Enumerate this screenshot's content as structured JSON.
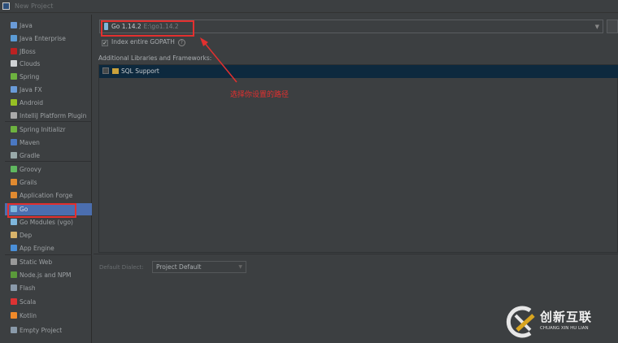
{
  "window": {
    "title": "New Project"
  },
  "sidebar": {
    "items": [
      {
        "label": "Java",
        "icon": "java-folder-icon",
        "color": "#6a9bd8"
      },
      {
        "label": "Java Enterprise",
        "icon": "java-ee-icon",
        "color": "#5b9bd5"
      },
      {
        "label": "JBoss",
        "icon": "jboss-icon",
        "color": "#b22"
      },
      {
        "label": "Clouds",
        "icon": "clouds-icon",
        "color": "#cfd2d4"
      },
      {
        "label": "Spring",
        "icon": "spring-icon",
        "color": "#6db33f"
      },
      {
        "label": "Java FX",
        "icon": "javafx-folder-icon",
        "color": "#6a9bd8"
      },
      {
        "label": "Android",
        "icon": "android-icon",
        "color": "#97c024"
      },
      {
        "label": "IntelliJ Platform Plugin",
        "icon": "plugin-icon",
        "color": "#aaa"
      },
      {
        "label": "Spring Initializr",
        "icon": "spring-initializr-icon",
        "color": "#6db33f"
      },
      {
        "label": "Maven",
        "icon": "maven-icon",
        "color": "#4a78c2"
      },
      {
        "label": "Gradle",
        "icon": "gradle-icon",
        "color": "#9aa"
      },
      {
        "label": "Groovy",
        "icon": "groovy-icon",
        "color": "#5fb85f"
      },
      {
        "label": "Grails",
        "icon": "grails-icon",
        "color": "#e08a30"
      },
      {
        "label": "Application Forge",
        "icon": "application-forge-icon",
        "color": "#e08a30"
      },
      {
        "label": "Go",
        "icon": "go-icon",
        "color": "#7eb6dc",
        "selected": true
      },
      {
        "label": "Go Modules (vgo)",
        "icon": "go-modules-icon",
        "color": "#7eb6dc"
      },
      {
        "label": "Dep",
        "icon": "dep-icon",
        "color": "#d8b36a"
      },
      {
        "label": "App Engine",
        "icon": "app-engine-icon",
        "color": "#4a8fd8"
      },
      {
        "label": "Static Web",
        "icon": "static-web-icon",
        "color": "#999"
      },
      {
        "label": "Node.js and NPM",
        "icon": "nodejs-icon",
        "color": "#5a9a3a"
      },
      {
        "label": "Flash",
        "icon": "flash-icon",
        "color": "#8a9aaa"
      },
      {
        "label": "Scala",
        "icon": "scala-icon",
        "color": "#d33"
      },
      {
        "label": "Kotlin",
        "icon": "kotlin-icon",
        "color": "#f08a2a"
      },
      {
        "label": "Empty Project",
        "icon": "empty-project-icon",
        "color": "#8a9aaa"
      }
    ]
  },
  "sdk": {
    "name": "Go 1.14.2",
    "path": "E:\\go1.14.2"
  },
  "gopath": {
    "label": "Index entire GOPATH",
    "checked": true,
    "help": "?"
  },
  "libraries": {
    "label": "Additional Libraries and Frameworks:",
    "items": [
      {
        "label": "SQL Support",
        "checked": false
      }
    ]
  },
  "dialect": {
    "label": "Default Dialect:",
    "value": "Project Default"
  },
  "annotation": {
    "text": "选择你设置的路径"
  },
  "watermark": {
    "name": "创新互联",
    "sub": "CHUANG XIN HU LIAN"
  },
  "colors": {
    "accent": "#4b6eaf",
    "annotation": "#e3302f",
    "selection": "#0d293e"
  }
}
